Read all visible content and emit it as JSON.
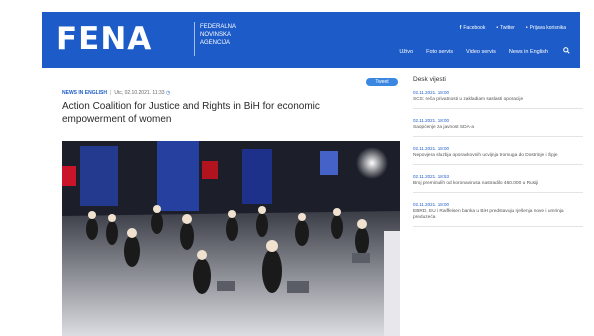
{
  "header": {
    "logo": "FENA",
    "agency_lines": [
      "FEDERALNA",
      "NOVINSKA",
      "AGENCIJA"
    ],
    "social": [
      {
        "icon": "facebook-icon",
        "glyph": "f",
        "label": "Facebook"
      },
      {
        "icon": "twitter-icon",
        "glyph": "•",
        "label": "Twitter"
      },
      {
        "icon": "login-icon",
        "glyph": "•",
        "label": "Prijava korisnika"
      }
    ],
    "nav": [
      "Uživo",
      "Foto servis",
      "Video servis",
      "News in English"
    ]
  },
  "article": {
    "tweet_label": "Tweet",
    "category": "NEWS IN ENGLISH",
    "date": "Utc, 02.10.2021. 11:33",
    "title": "Action Coalition for Justice and Rights in BiH for economic empowerment of women"
  },
  "sidebar": {
    "title": "Desk vijesti",
    "items": [
      {
        "date": "02.11.2021. 18:00",
        "text": "SCS: reča privatnosti u zakladiam saslasti oporacije"
      },
      {
        "date": "02.11.2021. 18:00",
        "text": "Saopćenje za javnost SDA-a"
      },
      {
        "date": "02.11.2021. 18:00",
        "text": "Nepovjera sluzbja oporavkovnih ucvijnja tromuga do Dostrinje i Špje"
      },
      {
        "date": "02.11.2021. 18:53",
        "text": "Broj preminulih od koronavirusa nastradilo 460.000 u Rusiji"
      },
      {
        "date": "02.11.2021. 18:00",
        "text": "EBRD, EU i Raiffeisen banka u BiH predstavuju rješenja nove i umrinja preduzeća"
      }
    ]
  },
  "colors": {
    "brand": "#1d5cc8",
    "tweet": "#3b86e0"
  }
}
